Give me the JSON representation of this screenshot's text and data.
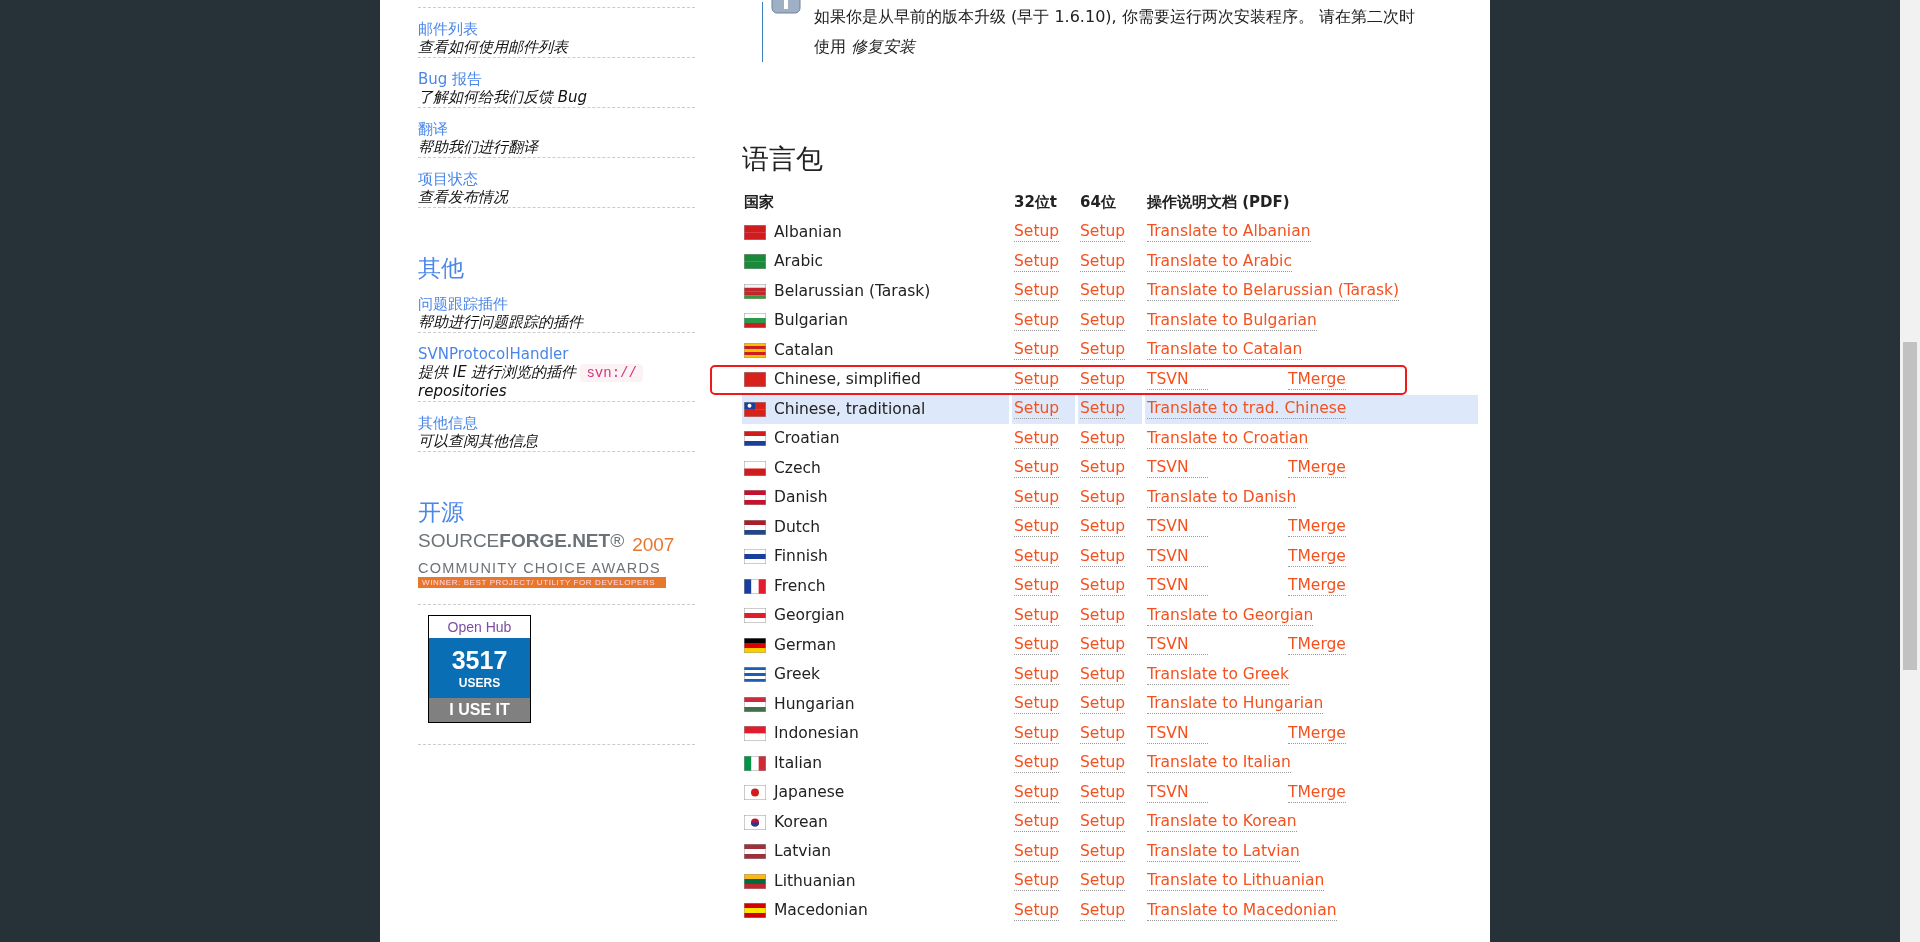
{
  "sidebar": {
    "items": [
      {
        "link": "邮件列表",
        "description": "查看如何使用邮件列表"
      },
      {
        "link": "Bug 报告",
        "description": "了解如何给我们反馈 Bug"
      },
      {
        "link": "翻译",
        "description": "帮助我们进行翻译"
      },
      {
        "link": "项目状态",
        "description": "查看发布情况"
      }
    ],
    "sections": [
      {
        "title": "其他",
        "items": [
          {
            "link": "问题跟踪插件",
            "description": "帮助进行问题跟踪的插件"
          },
          {
            "link": "SVNProtocolHandler",
            "description": "提供 IE 进行浏览的插件",
            "code": "svn://",
            "description_end": "repositories"
          },
          {
            "link": "其他信息",
            "description": "可以查阅其他信息"
          }
        ]
      },
      {
        "title": "开源",
        "award": {
          "brand": "SOURCE**FORGE.NET**®",
          "year": "2007",
          "subtitle": "COMMUNITY CHOICE AWARDS",
          "ribbon": "WINNER: BEST PROJECT/ UTILITY FOR DEVELOPERS"
        },
        "openhub": {
          "title": "Open Hub",
          "count": "3517",
          "unit": "USERS",
          "footer": "I USE IT"
        }
      }
    ]
  },
  "notice": {
    "text": "如果你是从早前的版本升级 (早于 1.6.10), 你需要运行两次安装程序。 请在第二次时使用 *修复安装*"
  },
  "language_packs": {
    "title": "语言包",
    "columns": [
      "国家",
      "32位t",
      "64位",
      "操作说明文档 (PDF)"
    ],
    "rows": [
      {
        "country": "Albanian",
        "setup32": "Setup",
        "setup64": "Setup",
        "docs": [
          "Translate to Albanian"
        ],
        "highlighted": false,
        "marked": false
      },
      {
        "country": "Arabic",
        "setup32": "Setup",
        "setup64": "Setup",
        "docs": [
          "Translate to Arabic"
        ],
        "highlighted": false,
        "marked": false
      },
      {
        "country": "Belarussian (Tarask)",
        "setup32": "Setup",
        "setup64": "Setup",
        "docs": [
          "Translate to Belarussian (Tarask)"
        ],
        "highlighted": false,
        "marked": false
      },
      {
        "country": "Bulgarian",
        "setup32": "Setup",
        "setup64": "Setup",
        "docs": [
          "Translate to Bulgarian"
        ],
        "highlighted": false,
        "marked": false
      },
      {
        "country": "Catalan",
        "setup32": "Setup",
        "setup64": "Setup",
        "docs": [
          "Translate to Catalan"
        ],
        "highlighted": false,
        "marked": false
      },
      {
        "country": "Chinese, simplified",
        "setup32": "Setup",
        "setup64": "Setup",
        "docs": [
          "TSVN",
          "TMerge"
        ],
        "highlighted": false,
        "marked": true
      },
      {
        "country": "Chinese, traditional",
        "setup32": "Setup",
        "setup64": "Setup",
        "docs": [
          "Translate to trad. Chinese"
        ],
        "highlighted": true,
        "marked": false
      },
      {
        "country": "Croatian",
        "setup32": "Setup",
        "setup64": "Setup",
        "docs": [
          "Translate to Croatian"
        ],
        "highlighted": false,
        "marked": false
      },
      {
        "country": "Czech",
        "setup32": "Setup",
        "setup64": "Setup",
        "docs": [
          "TSVN",
          "TMerge"
        ],
        "highlighted": false,
        "marked": false
      },
      {
        "country": "Danish",
        "setup32": "Setup",
        "setup64": "Setup",
        "docs": [
          "Translate to Danish"
        ],
        "highlighted": false,
        "marked": false
      },
      {
        "country": "Dutch",
        "setup32": "Setup",
        "setup64": "Setup",
        "docs": [
          "TSVN",
          "TMerge"
        ],
        "highlighted": false,
        "marked": false
      },
      {
        "country": "Finnish",
        "setup32": "Setup",
        "setup64": "Setup",
        "docs": [
          "TSVN",
          "TMerge"
        ],
        "highlighted": false,
        "marked": false
      },
      {
        "country": "French",
        "setup32": "Setup",
        "setup64": "Setup",
        "docs": [
          "TSVN",
          "TMerge"
        ],
        "highlighted": false,
        "marked": false
      },
      {
        "country": "Georgian",
        "setup32": "Setup",
        "setup64": "Setup",
        "docs": [
          "Translate to Georgian"
        ],
        "highlighted": false,
        "marked": false
      },
      {
        "country": "German",
        "setup32": "Setup",
        "setup64": "Setup",
        "docs": [
          "TSVN",
          "TMerge"
        ],
        "highlighted": false,
        "marked": false
      },
      {
        "country": "Greek",
        "setup32": "Setup",
        "setup64": "Setup",
        "docs": [
          "Translate to Greek"
        ],
        "highlighted": false,
        "marked": false
      },
      {
        "country": "Hungarian",
        "setup32": "Setup",
        "setup64": "Setup",
        "docs": [
          "Translate to Hungarian"
        ],
        "highlighted": false,
        "marked": false
      },
      {
        "country": "Indonesian",
        "setup32": "Setup",
        "setup64": "Setup",
        "docs": [
          "TSVN",
          "TMerge"
        ],
        "highlighted": false,
        "marked": false
      },
      {
        "country": "Italian",
        "setup32": "Setup",
        "setup64": "Setup",
        "docs": [
          "Translate to Italian"
        ],
        "highlighted": false,
        "marked": false
      },
      {
        "country": "Japanese",
        "setup32": "Setup",
        "setup64": "Setup",
        "docs": [
          "TSVN",
          "TMerge"
        ],
        "highlighted": false,
        "marked": false
      },
      {
        "country": "Korean",
        "setup32": "Setup",
        "setup64": "Setup",
        "docs": [
          "Translate to Korean"
        ],
        "highlighted": false,
        "marked": false
      },
      {
        "country": "Latvian",
        "setup32": "Setup",
        "setup64": "Setup",
        "docs": [
          "Translate to Latvian"
        ],
        "highlighted": false,
        "marked": false
      },
      {
        "country": "Lithuanian",
        "setup32": "Setup",
        "setup64": "Setup",
        "docs": [
          "Translate to Lithuanian"
        ],
        "highlighted": false,
        "marked": false
      },
      {
        "country": "Macedonian",
        "setup32": "Setup",
        "setup64": "Setup",
        "docs": [
          "Translate to Macedonian"
        ],
        "highlighted": false,
        "marked": false
      }
    ]
  }
}
